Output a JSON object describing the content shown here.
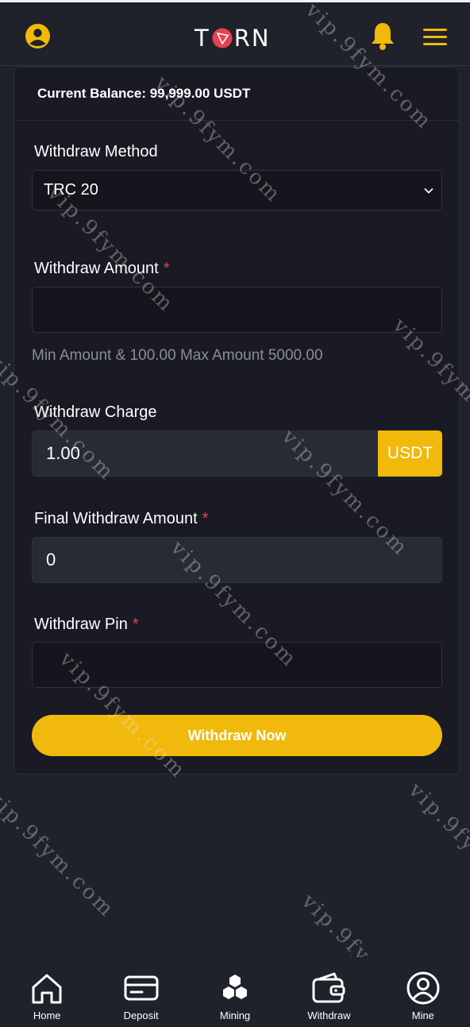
{
  "header": {
    "logo_left": "T",
    "logo_right": "RN",
    "icons": [
      "user-circle-icon",
      "bell-icon",
      "hamburger-menu-icon"
    ],
    "accent_color": "#f0b90b"
  },
  "balance": {
    "text": "Current Balance: 99,999.00 USDT"
  },
  "form": {
    "method_label": "Withdraw Method",
    "method_value": "TRC 20",
    "amount_label": "Withdraw Amount",
    "amount_value": "",
    "amount_hint": "Min Amount & 100.00 Max Amount 5000.00",
    "charge_label": "Withdraw Charge",
    "charge_value": "1.00",
    "charge_unit": "USDT",
    "final_label": "Final Withdraw Amount",
    "final_value": "0",
    "pin_label": "Withdraw Pin",
    "pin_value": "",
    "required_mark": "*",
    "submit_label": "Withdraw Now"
  },
  "watermark_text": "vip.9fym.com",
  "nav": {
    "items": [
      {
        "label": "Home",
        "icon": "home-icon"
      },
      {
        "label": "Deposit",
        "icon": "card-icon"
      },
      {
        "label": "Mining",
        "icon": "hexagons-icon"
      },
      {
        "label": "Withdraw",
        "icon": "wallet-icon"
      },
      {
        "label": "Mine",
        "icon": "user-icon"
      }
    ]
  }
}
